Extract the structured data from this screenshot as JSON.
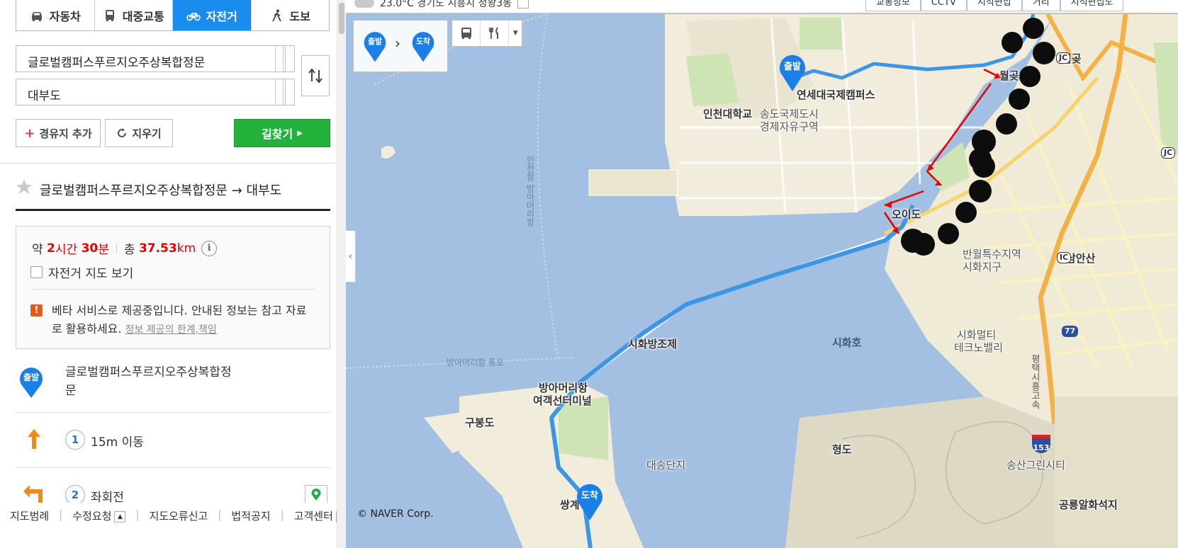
{
  "modes": {
    "car": "자동차",
    "transit": "대중교통",
    "bike": "자전거",
    "walk": "도보"
  },
  "route": {
    "origin": "글로벌캠퍼스푸르지오주상복합정문",
    "destination": "대부도",
    "add_waypoint": "경유지 추가",
    "clear": "지우기",
    "search": "길찾기",
    "header_title": "글로벌캠퍼스푸르지오주상복합정문 → 대부도"
  },
  "summary": {
    "about": "약",
    "hours": "2",
    "hours_unit": "시간",
    "minutes": "30",
    "minutes_unit": "분",
    "total": "총",
    "distance": "37.53",
    "distance_unit": "km",
    "info_glyph": "i",
    "bike_map_label": "자전거 지도 보기",
    "beta_notice": "베타 서비스로 제공중입니다. 안내된 정보는 참고 자료로 활용하세요.",
    "beta_link": "정보 제공의 한계,책임"
  },
  "steps": [
    {
      "badge": "출발",
      "text": "글로벌캠퍼스푸르지오주상복합정문",
      "icon": "start-pin-icon"
    },
    {
      "num": "1",
      "text": "15m 이동",
      "icon": "arrow-up-icon",
      "color": "#f08a1a"
    },
    {
      "num": "2",
      "text": "좌회전",
      "icon": "turn-left-icon",
      "color": "#f08a1a"
    }
  ],
  "footer": {
    "items": [
      "지도범례",
      "수정요청",
      "지도오류신고",
      "법적공지",
      "고객센터"
    ]
  },
  "map": {
    "topbar_weather": "23.0°C 경기도 시흥시 정왕3동",
    "topbar_tools": [
      "교통정보",
      "CCTV",
      "지적편집",
      "거리",
      "지적편집도"
    ],
    "start_badge": "출발",
    "end_badge": "도착",
    "copyright": "© NAVER Corp.",
    "labels": {
      "yonsei": "연세대국제캠퍼스",
      "incheon_univ": "인천대학교",
      "songdo": "송도국제도시",
      "songdo2": "경제자유구역",
      "wolgot": "월곶",
      "wolgot_ic": "월곶",
      "oido": "오이도",
      "banwol": "반월특수지역",
      "banwol2": "시화지구",
      "namansan": "남안산",
      "sihwa_lake": "시화호",
      "sihwa_mtv": "시화멀티",
      "sihwa_mtv2": "테크노밸리",
      "sihwa_dike": "시화방조제",
      "bangamori": "방아머리항",
      "bangamori2": "여객선터미널",
      "bangamori_ch": "방아머리항 통로",
      "incheon_ch": "인천항 방아머리항",
      "gubongdo": "구봉도",
      "daesong": "대송단지",
      "hyeongdo": "형도",
      "songsan": "송산그린시티",
      "gongryong": "공룡알화석지",
      "ssanggye": "쌍계",
      "hw_77": "77",
      "hw_153": "153",
      "jc": "JC",
      "ic": "IC",
      "vertical_road": "평택시흥고속"
    },
    "colors": {
      "route": "#3c96e6",
      "arrow": "#e60000",
      "water": "#9fbde0",
      "land": "#f0ebd9",
      "accent": "#1a8cf0"
    }
  }
}
